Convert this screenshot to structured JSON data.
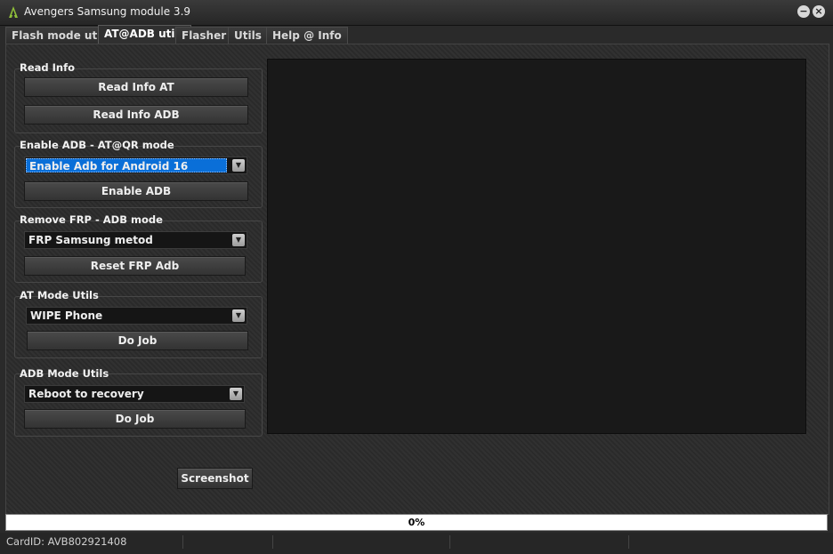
{
  "window": {
    "title": "Avengers Samsung module 3.9",
    "min_glyph": "−",
    "close_glyph": "×"
  },
  "tabs": [
    {
      "label": "Flash mode utils"
    },
    {
      "label": "AT@ADB utils",
      "active": true
    },
    {
      "label": "Flasher"
    },
    {
      "label": "Utils"
    },
    {
      "label": "Help @ Info"
    }
  ],
  "read_info": {
    "label": "Read Info",
    "btn_at": "Read Info AT",
    "btn_adb": "Read Info ADB"
  },
  "enable_adb": {
    "label": "Enable ADB - AT@QR mode",
    "selected": "Enable Adb for Android 16",
    "button": "Enable ADB"
  },
  "remove_frp": {
    "label": "Remove FRP - ADB mode",
    "selected": "FRP Samsung metod",
    "button": "Reset FRP Adb"
  },
  "at_mode": {
    "label": "AT Mode Utils",
    "selected": "WIPE Phone",
    "button": "Do Job"
  },
  "adb_mode": {
    "label": "ADB Mode Utils",
    "selected": "Reboot to recovery",
    "button": "Do Job"
  },
  "screenshot_button": "Screenshot",
  "progress": {
    "value": 0,
    "text": "0%"
  },
  "status": {
    "card_id": "CardID: AVB802921408"
  },
  "colors": {
    "accent": "#0a6fd8",
    "background": "#2a2a2a",
    "log_bg": "#191919"
  },
  "icons": {
    "app": "avengers-logo-icon",
    "combo_arrow": "chevron-down-icon"
  }
}
